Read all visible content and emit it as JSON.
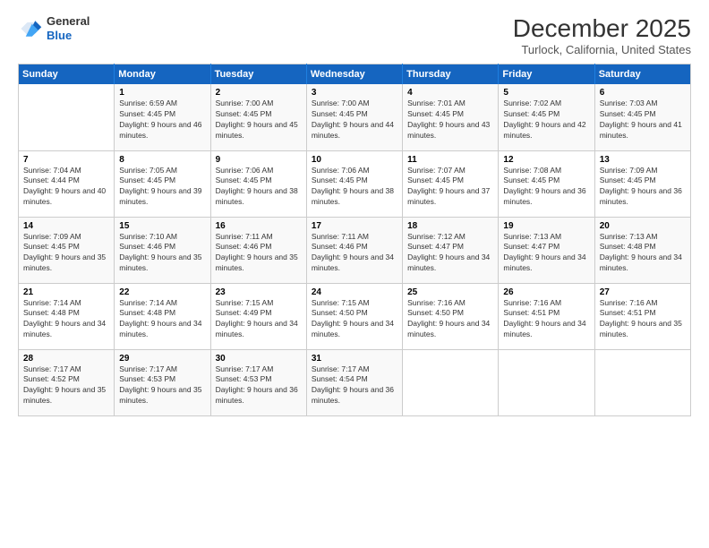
{
  "logo": {
    "general": "General",
    "blue": "Blue"
  },
  "header": {
    "month": "December 2025",
    "location": "Turlock, California, United States"
  },
  "weekdays": [
    "Sunday",
    "Monday",
    "Tuesday",
    "Wednesday",
    "Thursday",
    "Friday",
    "Saturday"
  ],
  "weeks": [
    [
      {
        "day": "",
        "sunrise": "",
        "sunset": "",
        "daylight": ""
      },
      {
        "day": "1",
        "sunrise": "Sunrise: 6:59 AM",
        "sunset": "Sunset: 4:45 PM",
        "daylight": "Daylight: 9 hours and 46 minutes."
      },
      {
        "day": "2",
        "sunrise": "Sunrise: 7:00 AM",
        "sunset": "Sunset: 4:45 PM",
        "daylight": "Daylight: 9 hours and 45 minutes."
      },
      {
        "day": "3",
        "sunrise": "Sunrise: 7:00 AM",
        "sunset": "Sunset: 4:45 PM",
        "daylight": "Daylight: 9 hours and 44 minutes."
      },
      {
        "day": "4",
        "sunrise": "Sunrise: 7:01 AM",
        "sunset": "Sunset: 4:45 PM",
        "daylight": "Daylight: 9 hours and 43 minutes."
      },
      {
        "day": "5",
        "sunrise": "Sunrise: 7:02 AM",
        "sunset": "Sunset: 4:45 PM",
        "daylight": "Daylight: 9 hours and 42 minutes."
      },
      {
        "day": "6",
        "sunrise": "Sunrise: 7:03 AM",
        "sunset": "Sunset: 4:45 PM",
        "daylight": "Daylight: 9 hours and 41 minutes."
      }
    ],
    [
      {
        "day": "7",
        "sunrise": "Sunrise: 7:04 AM",
        "sunset": "Sunset: 4:44 PM",
        "daylight": "Daylight: 9 hours and 40 minutes."
      },
      {
        "day": "8",
        "sunrise": "Sunrise: 7:05 AM",
        "sunset": "Sunset: 4:45 PM",
        "daylight": "Daylight: 9 hours and 39 minutes."
      },
      {
        "day": "9",
        "sunrise": "Sunrise: 7:06 AM",
        "sunset": "Sunset: 4:45 PM",
        "daylight": "Daylight: 9 hours and 38 minutes."
      },
      {
        "day": "10",
        "sunrise": "Sunrise: 7:06 AM",
        "sunset": "Sunset: 4:45 PM",
        "daylight": "Daylight: 9 hours and 38 minutes."
      },
      {
        "day": "11",
        "sunrise": "Sunrise: 7:07 AM",
        "sunset": "Sunset: 4:45 PM",
        "daylight": "Daylight: 9 hours and 37 minutes."
      },
      {
        "day": "12",
        "sunrise": "Sunrise: 7:08 AM",
        "sunset": "Sunset: 4:45 PM",
        "daylight": "Daylight: 9 hours and 36 minutes."
      },
      {
        "day": "13",
        "sunrise": "Sunrise: 7:09 AM",
        "sunset": "Sunset: 4:45 PM",
        "daylight": "Daylight: 9 hours and 36 minutes."
      }
    ],
    [
      {
        "day": "14",
        "sunrise": "Sunrise: 7:09 AM",
        "sunset": "Sunset: 4:45 PM",
        "daylight": "Daylight: 9 hours and 35 minutes."
      },
      {
        "day": "15",
        "sunrise": "Sunrise: 7:10 AM",
        "sunset": "Sunset: 4:46 PM",
        "daylight": "Daylight: 9 hours and 35 minutes."
      },
      {
        "day": "16",
        "sunrise": "Sunrise: 7:11 AM",
        "sunset": "Sunset: 4:46 PM",
        "daylight": "Daylight: 9 hours and 35 minutes."
      },
      {
        "day": "17",
        "sunrise": "Sunrise: 7:11 AM",
        "sunset": "Sunset: 4:46 PM",
        "daylight": "Daylight: 9 hours and 34 minutes."
      },
      {
        "day": "18",
        "sunrise": "Sunrise: 7:12 AM",
        "sunset": "Sunset: 4:47 PM",
        "daylight": "Daylight: 9 hours and 34 minutes."
      },
      {
        "day": "19",
        "sunrise": "Sunrise: 7:13 AM",
        "sunset": "Sunset: 4:47 PM",
        "daylight": "Daylight: 9 hours and 34 minutes."
      },
      {
        "day": "20",
        "sunrise": "Sunrise: 7:13 AM",
        "sunset": "Sunset: 4:48 PM",
        "daylight": "Daylight: 9 hours and 34 minutes."
      }
    ],
    [
      {
        "day": "21",
        "sunrise": "Sunrise: 7:14 AM",
        "sunset": "Sunset: 4:48 PM",
        "daylight": "Daylight: 9 hours and 34 minutes."
      },
      {
        "day": "22",
        "sunrise": "Sunrise: 7:14 AM",
        "sunset": "Sunset: 4:48 PM",
        "daylight": "Daylight: 9 hours and 34 minutes."
      },
      {
        "day": "23",
        "sunrise": "Sunrise: 7:15 AM",
        "sunset": "Sunset: 4:49 PM",
        "daylight": "Daylight: 9 hours and 34 minutes."
      },
      {
        "day": "24",
        "sunrise": "Sunrise: 7:15 AM",
        "sunset": "Sunset: 4:50 PM",
        "daylight": "Daylight: 9 hours and 34 minutes."
      },
      {
        "day": "25",
        "sunrise": "Sunrise: 7:16 AM",
        "sunset": "Sunset: 4:50 PM",
        "daylight": "Daylight: 9 hours and 34 minutes."
      },
      {
        "day": "26",
        "sunrise": "Sunrise: 7:16 AM",
        "sunset": "Sunset: 4:51 PM",
        "daylight": "Daylight: 9 hours and 34 minutes."
      },
      {
        "day": "27",
        "sunrise": "Sunrise: 7:16 AM",
        "sunset": "Sunset: 4:51 PM",
        "daylight": "Daylight: 9 hours and 35 minutes."
      }
    ],
    [
      {
        "day": "28",
        "sunrise": "Sunrise: 7:17 AM",
        "sunset": "Sunset: 4:52 PM",
        "daylight": "Daylight: 9 hours and 35 minutes."
      },
      {
        "day": "29",
        "sunrise": "Sunrise: 7:17 AM",
        "sunset": "Sunset: 4:53 PM",
        "daylight": "Daylight: 9 hours and 35 minutes."
      },
      {
        "day": "30",
        "sunrise": "Sunrise: 7:17 AM",
        "sunset": "Sunset: 4:53 PM",
        "daylight": "Daylight: 9 hours and 36 minutes."
      },
      {
        "day": "31",
        "sunrise": "Sunrise: 7:17 AM",
        "sunset": "Sunset: 4:54 PM",
        "daylight": "Daylight: 9 hours and 36 minutes."
      },
      {
        "day": "",
        "sunrise": "",
        "sunset": "",
        "daylight": ""
      },
      {
        "day": "",
        "sunrise": "",
        "sunset": "",
        "daylight": ""
      },
      {
        "day": "",
        "sunrise": "",
        "sunset": "",
        "daylight": ""
      }
    ]
  ]
}
